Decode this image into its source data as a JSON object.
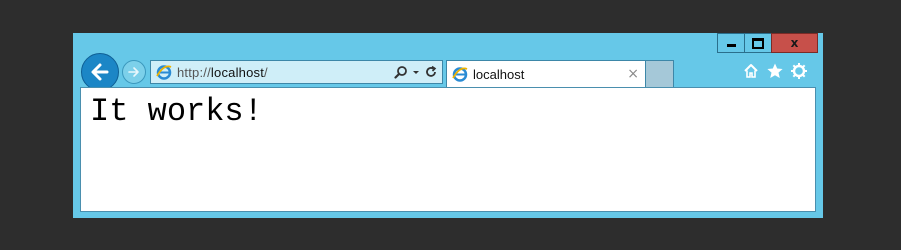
{
  "window": {
    "controls": {
      "minimize_icon": "minimize-icon",
      "maximize_icon": "maximize-icon",
      "close_label": "x"
    }
  },
  "nav": {
    "back_icon": "back-arrow-icon",
    "forward_icon": "forward-arrow-icon"
  },
  "address": {
    "protocol": "http://",
    "host": "localhost",
    "path": "/",
    "search_icon": "search-icon",
    "dropdown_icon": "dropdown-icon",
    "refresh_icon": "refresh-icon"
  },
  "tabs": [
    {
      "label": "localhost",
      "close": "×"
    }
  ],
  "toolbar": {
    "icons": [
      "home-icon",
      "favorites-star-icon",
      "settings-gear-icon"
    ]
  },
  "page": {
    "heading": "It works!"
  },
  "colors": {
    "frame": "#66c8e8",
    "close_button": "#c7504a",
    "back_button": "#1b86c6",
    "background": "#2d2d2d"
  }
}
